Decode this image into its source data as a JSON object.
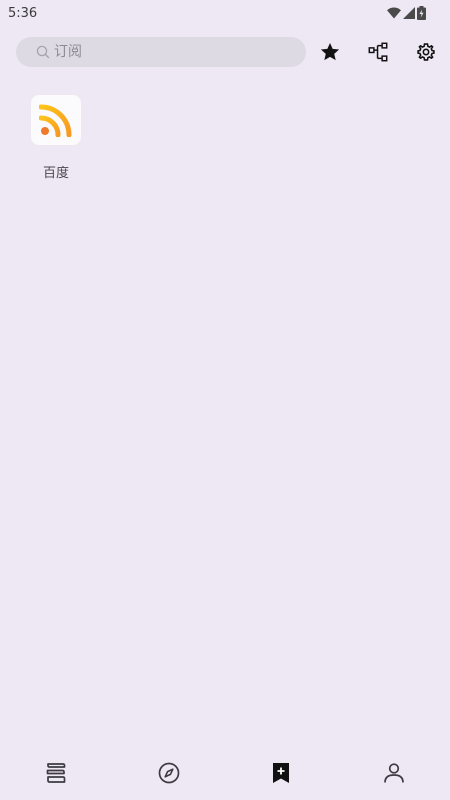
{
  "status_bar": {
    "time": "5:36",
    "icons": [
      "wifi-icon",
      "cellular-signal-icon",
      "battery-charging-icon"
    ]
  },
  "toolbar": {
    "search_placeholder": "订阅",
    "actions": [
      "star-icon",
      "group-icon",
      "gear-icon"
    ]
  },
  "sources": [
    {
      "label": "百度",
      "icon": "rss-icon"
    }
  ],
  "bottom_nav": {
    "items": [
      {
        "icon": "bookshelf-icon",
        "active": false
      },
      {
        "icon": "compass-icon",
        "active": false
      },
      {
        "icon": "bookmark-add-icon",
        "active": true
      },
      {
        "icon": "person-icon",
        "active": false
      }
    ]
  },
  "colors": {
    "background": "#EEE8F4",
    "search_bg": "#DEDAE4",
    "rss_orange": "#F5A623",
    "rss_dot": "#EE7A2B"
  }
}
